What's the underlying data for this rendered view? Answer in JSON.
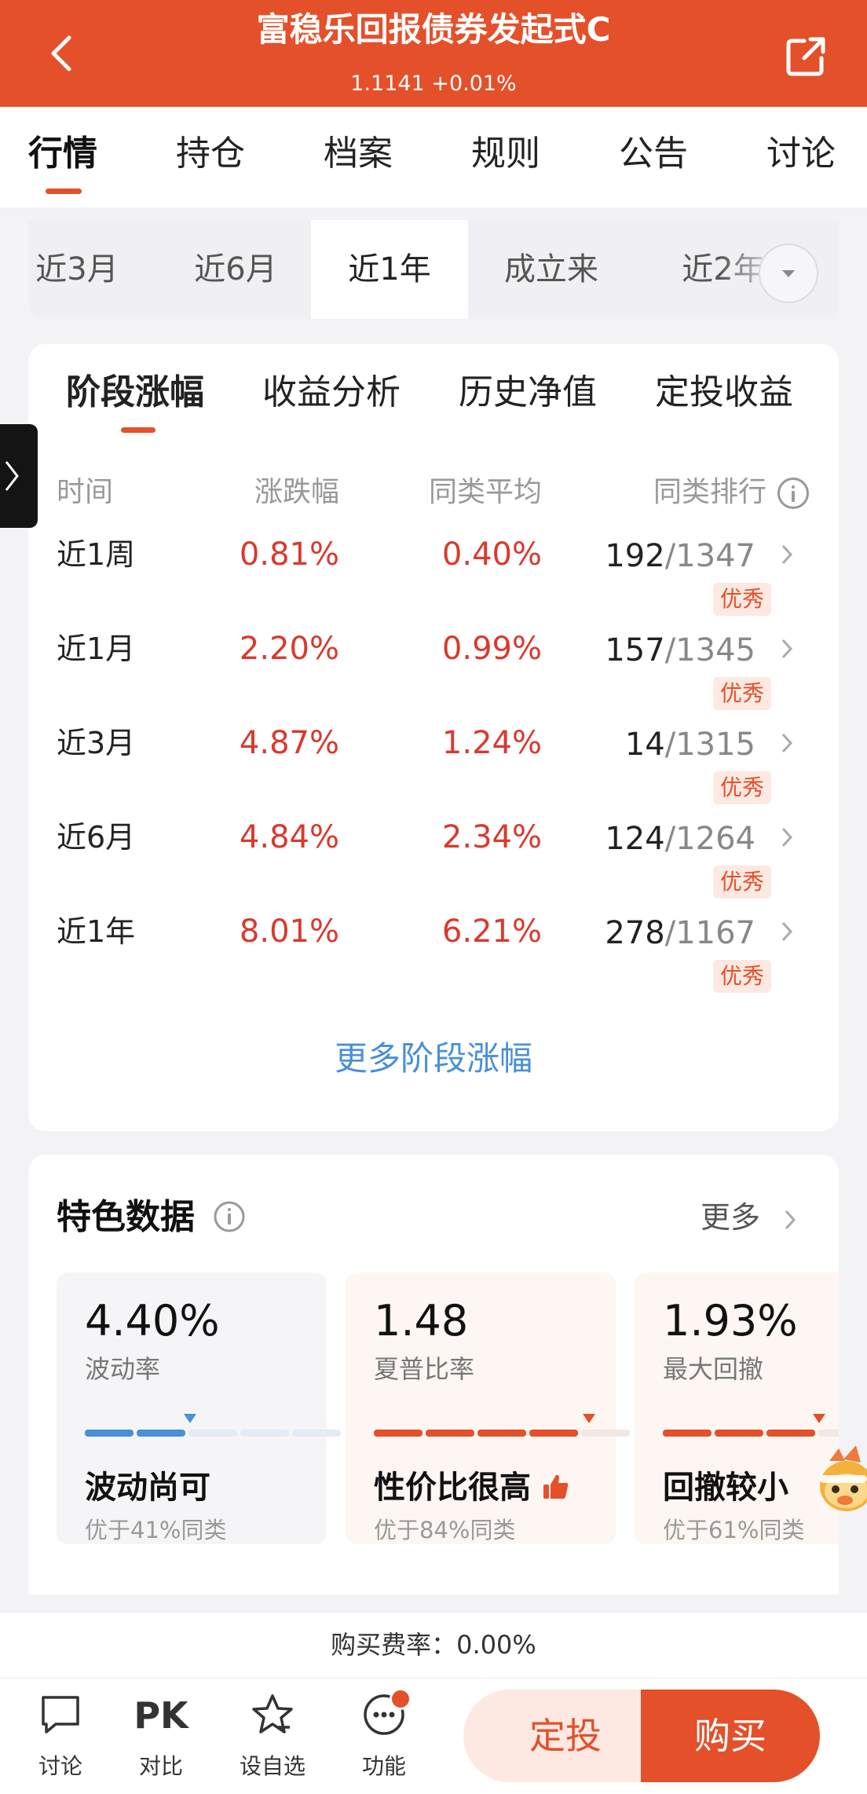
{
  "header": {
    "title": "富稳乐回报债券发起式C",
    "subtitle": "1.1141  +0.01%"
  },
  "main_tabs": [
    {
      "label": "行情",
      "active": true
    },
    {
      "label": "持仓"
    },
    {
      "label": "档案"
    },
    {
      "label": "规则"
    },
    {
      "label": "公告"
    },
    {
      "label": "讨论"
    }
  ],
  "period_tabs": [
    {
      "label": "近3月"
    },
    {
      "label": "近6月"
    },
    {
      "label": "近1年",
      "active": true
    },
    {
      "label": "成立来"
    },
    {
      "label": "近2年"
    }
  ],
  "sub_tabs": [
    {
      "label": "阶段涨幅",
      "active": true
    },
    {
      "label": "收益分析"
    },
    {
      "label": "历史净值"
    },
    {
      "label": "定投收益"
    }
  ],
  "table": {
    "headers": [
      "时间",
      "涨跌幅",
      "同类平均",
      "同类排行"
    ],
    "rows": [
      {
        "period": "近1周",
        "change": "0.81%",
        "avg": "0.40%",
        "rank": "192",
        "total": "/1347",
        "badge": "优秀"
      },
      {
        "period": "近1月",
        "change": "2.20%",
        "avg": "0.99%",
        "rank": "157",
        "total": "/1345",
        "badge": "优秀"
      },
      {
        "period": "近3月",
        "change": "4.87%",
        "avg": "1.24%",
        "rank": "14",
        "total": "/1315",
        "badge": "优秀"
      },
      {
        "period": "近6月",
        "change": "4.84%",
        "avg": "2.34%",
        "rank": "124",
        "total": "/1264",
        "badge": "优秀"
      },
      {
        "period": "近1年",
        "change": "8.01%",
        "avg": "6.21%",
        "rank": "278",
        "total": "/1167",
        "badge": "优秀"
      }
    ],
    "more_link": "更多阶段涨幅"
  },
  "features": {
    "title": "特色数据",
    "more": "更多",
    "metrics": [
      {
        "value": "4.40%",
        "label": "波动率",
        "verdict": "波动尚可",
        "note": "优于41%同类",
        "level": 0.41,
        "color": "#4a8fd8"
      },
      {
        "value": "1.48",
        "label": "夏普比率",
        "verdict": "性价比很高",
        "note": "优于84%同类",
        "level": 0.84,
        "color": "#e4502a"
      },
      {
        "value": "1.93%",
        "label": "最大回撤",
        "verdict": "回撤较小",
        "note": "优于61%同类",
        "level": 0.61,
        "color": "#e4502a"
      }
    ]
  },
  "fee": "购买费率：0.00%",
  "bottom_nav": {
    "items": [
      {
        "label": "讨论"
      },
      {
        "label": "对比",
        "glyph": "PK"
      },
      {
        "label": "设自选"
      },
      {
        "label": "功能"
      }
    ],
    "dingtou": "定投",
    "buy": "购买"
  },
  "colors": {
    "brand": "#e4502a",
    "up": "#d83a2e",
    "link": "#4a8fd8"
  }
}
